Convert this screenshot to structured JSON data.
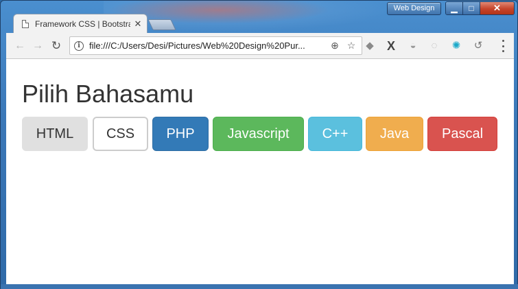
{
  "window": {
    "profile_label": "Web Design",
    "minimize_glyph": "▁",
    "maximize_glyph": "□",
    "close_glyph": "✕"
  },
  "tab": {
    "title": "Framework CSS | Bootstrap",
    "close_glyph": "✕"
  },
  "toolbar": {
    "back_glyph": "←",
    "forward_glyph": "→",
    "reload_glyph": "↻",
    "url": "file:///C:/Users/Desi/Pictures/Web%20Design%20Pur...",
    "zoom_glyph": "⊕",
    "star_glyph": "☆",
    "extensions": [
      {
        "name": "box-extension-icon",
        "glyph": "◆",
        "color": "#8a8a8a"
      },
      {
        "name": "x-extension-icon",
        "glyph": "X",
        "color": "#444444"
      },
      {
        "name": "shield-extension-icon",
        "glyph": "◒",
        "color": "#9a9a9a"
      },
      {
        "name": "circle-extension-icon",
        "glyph": "◌",
        "color": "#b0b0b0"
      },
      {
        "name": "gear-extension-icon",
        "glyph": "✺",
        "color": "#1ba9c9"
      },
      {
        "name": "history-extension-icon",
        "glyph": "↺",
        "color": "#777777"
      }
    ]
  },
  "page": {
    "heading": "Pilih Bahasamu",
    "buttons": [
      {
        "label": "HTML",
        "variant": "default-active",
        "bg": "#e0e0e0",
        "border": "#e0e0e0",
        "color": "#333333"
      },
      {
        "label": "CSS",
        "variant": "default",
        "bg": "#ffffff",
        "border": "#cccccc",
        "color": "#333333"
      },
      {
        "label": "PHP",
        "variant": "primary",
        "bg": "#337ab7",
        "border": "#2e6da4",
        "color": "#ffffff"
      },
      {
        "label": "Javascript",
        "variant": "success",
        "bg": "#5cb85c",
        "border": "#4cae4c",
        "color": "#ffffff"
      },
      {
        "label": "C++",
        "variant": "info",
        "bg": "#5bc0de",
        "border": "#46b8da",
        "color": "#ffffff"
      },
      {
        "label": "Java",
        "variant": "warning",
        "bg": "#f0ad4e",
        "border": "#eea236",
        "color": "#ffffff"
      },
      {
        "label": "Pascal",
        "variant": "danger",
        "bg": "#d9534f",
        "border": "#d43f3a",
        "color": "#ffffff"
      }
    ]
  }
}
